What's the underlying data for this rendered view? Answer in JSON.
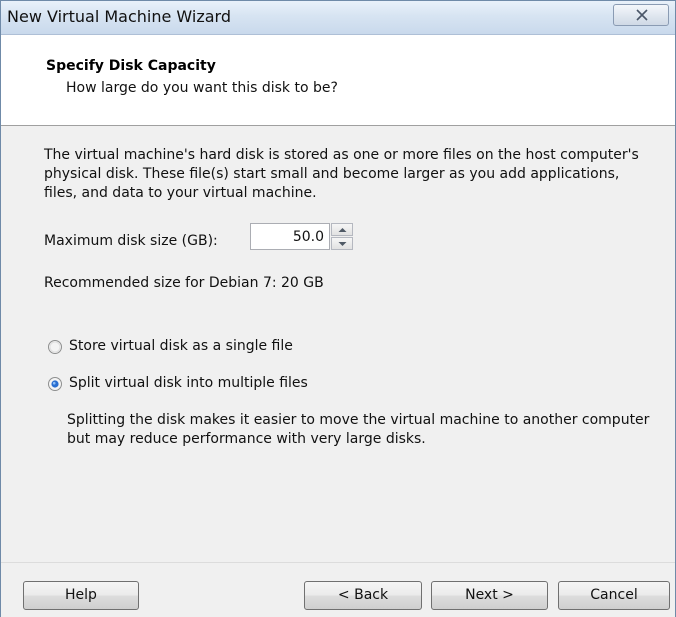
{
  "window": {
    "title": "New Virtual Machine Wizard"
  },
  "header": {
    "title": "Specify Disk Capacity",
    "subtitle": "How large do you want this disk to be?"
  },
  "content": {
    "description": "The virtual machine's hard disk is stored as one or more files on the host computer's physical disk. These file(s) start small and become larger as you add applications, files, and data to your virtual machine.",
    "max_disk_size_label": "Maximum disk size (GB):",
    "max_disk_size_value": "50.0",
    "recommended": "Recommended size for Debian 7: 20 GB",
    "options": [
      {
        "label": "Store virtual disk as a single file",
        "selected": false
      },
      {
        "label": "Split virtual disk into multiple files",
        "selected": true
      }
    ],
    "split_note": "Splitting the disk makes it easier to move the virtual machine to another computer but may reduce performance with very large disks."
  },
  "footer": {
    "help_label": "Help",
    "back_label": "< Back",
    "next_label": "Next >",
    "cancel_label": "Cancel"
  },
  "icons": {
    "close": "close-icon",
    "spin_up": "chevron-up-icon",
    "spin_down": "chevron-down-icon"
  },
  "colors": {
    "titlebar": "#d7e4f2",
    "dialog_bg": "#f0f0f0",
    "header_bg": "#ffffff",
    "radio_selected": "#2a6fd1"
  }
}
